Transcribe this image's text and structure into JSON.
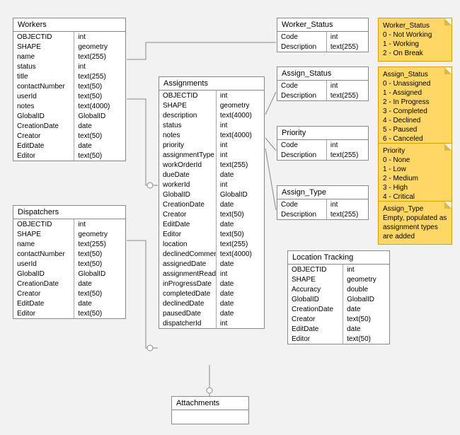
{
  "entities": {
    "workers": {
      "title": "Workers",
      "fields": [
        [
          "OBJECTID",
          "int"
        ],
        [
          "SHAPE",
          "geometry"
        ],
        [
          "name",
          "text(255)"
        ],
        [
          "status",
          "int"
        ],
        [
          "title",
          "text(255)"
        ],
        [
          "contactNumber",
          "text(50)"
        ],
        [
          "userId",
          "text(50)"
        ],
        [
          "notes",
          "text(4000)"
        ],
        [
          "GlobalID",
          "GlobalID"
        ],
        [
          "CreationDate",
          "date"
        ],
        [
          "Creator",
          "text(50)"
        ],
        [
          "EditDate",
          "date"
        ],
        [
          "Editor",
          "text(50)"
        ]
      ]
    },
    "dispatchers": {
      "title": "Dispatchers",
      "fields": [
        [
          "OBJECTID",
          "int"
        ],
        [
          "SHAPE",
          "geometry"
        ],
        [
          "name",
          "text(255)"
        ],
        [
          "contactNumber",
          "text(50)"
        ],
        [
          "userId",
          "text(50)"
        ],
        [
          "GlobalID",
          "GlobalID"
        ],
        [
          "CreationDate",
          "date"
        ],
        [
          "Creator",
          "text(50)"
        ],
        [
          "EditDate",
          "date"
        ],
        [
          "Editor",
          "text(50)"
        ]
      ]
    },
    "assignments": {
      "title": "Assignments",
      "fields": [
        [
          "OBJECTID",
          "int"
        ],
        [
          "SHAPE",
          "geometry"
        ],
        [
          "description",
          "text(4000)"
        ],
        [
          "status",
          "int"
        ],
        [
          "notes",
          "text(4000)"
        ],
        [
          "priority",
          "int"
        ],
        [
          "assignmentType",
          "int"
        ],
        [
          "workOrderId",
          "text(255)"
        ],
        [
          "dueDate",
          "date"
        ],
        [
          "workerId",
          "int"
        ],
        [
          "GlobalID",
          "GlobalID"
        ],
        [
          "CreationDate",
          "date"
        ],
        [
          "Creator",
          "text(50)"
        ],
        [
          "EditDate",
          "date"
        ],
        [
          "Editor",
          "text(50)"
        ],
        [
          "location",
          "text(255)"
        ],
        [
          "declinedComment",
          "text(4000)"
        ],
        [
          "assignedDate",
          "date"
        ],
        [
          "assignmentRead",
          "int"
        ],
        [
          "inProgressDate",
          "date"
        ],
        [
          "completedDate",
          "date"
        ],
        [
          "declinedDate",
          "date"
        ],
        [
          "pausedDate",
          "date"
        ],
        [
          "dispatcherId",
          "int"
        ]
      ]
    },
    "attachments": {
      "title": "Attachments",
      "fields": []
    },
    "worker_status": {
      "title": "Worker_Status",
      "fields": [
        [
          "Code",
          "int"
        ],
        [
          "Description",
          "text(255)"
        ]
      ]
    },
    "assign_status": {
      "title": "Assign_Status",
      "fields": [
        [
          "Code",
          "int"
        ],
        [
          "Description",
          "text(255)"
        ]
      ]
    },
    "priority": {
      "title": "Priority",
      "fields": [
        [
          "Code",
          "int"
        ],
        [
          "Description",
          "text(255)"
        ]
      ]
    },
    "assign_type": {
      "title": "Assign_Type",
      "fields": [
        [
          "Code",
          "int"
        ],
        [
          "Description",
          "text(255)"
        ]
      ]
    },
    "location_tracking": {
      "title": "Location Tracking",
      "fields": [
        [
          "OBJECTID",
          "int"
        ],
        [
          "SHAPE",
          "geometry"
        ],
        [
          "Accuracy",
          "double"
        ],
        [
          "GlobalID",
          "GlobalID"
        ],
        [
          "CreationDate",
          "date"
        ],
        [
          "Creator",
          "text(50)"
        ],
        [
          "EditDate",
          "date"
        ],
        [
          "Editor",
          "text(50)"
        ]
      ]
    }
  },
  "notes": {
    "worker_status": {
      "title": "Worker_Status",
      "lines": [
        "0 - Not Working",
        "1 - Working",
        "2 - On Break"
      ]
    },
    "assign_status": {
      "title": "Assign_Status",
      "lines": [
        "0 - Unassigned",
        "1 - Assigned",
        "2 - In Progress",
        "3 - Completed",
        "4 - Declined",
        "5 - Paused",
        "6 - Canceled"
      ]
    },
    "priority": {
      "title": "Priority",
      "lines": [
        "0 - None",
        "1 - Low",
        "2 - Medium",
        "3 - High",
        "4 - Critical"
      ]
    },
    "assign_type": {
      "title": "Assign_Type",
      "lines": [
        "Empty, populated as",
        "assignment types are added"
      ]
    }
  }
}
